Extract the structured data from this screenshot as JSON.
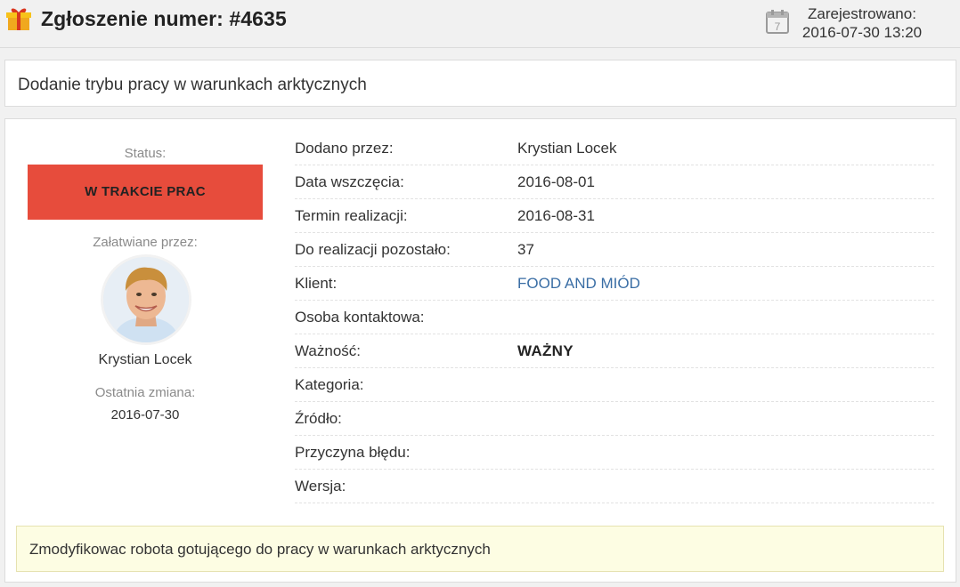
{
  "header": {
    "title": "Zgłoszenie numer: #4635",
    "registered_label": "Zarejestrowano:",
    "registered_value": "2016-07-30 13:20",
    "gift_icon": "gift-icon",
    "calendar_icon": "calendar-icon",
    "calendar_day": "7"
  },
  "subject": "Dodanie trybu pracy w warunkach arktycznych",
  "sidebar": {
    "status_label": "Status:",
    "status_value": "W TRAKCIE PRAC",
    "handler_label": "Załatwiane przez:",
    "handler_name": "Krystian Locek",
    "last_change_label": "Ostatnia zmiana:",
    "last_change_value": "2016-07-30"
  },
  "fields": [
    {
      "label": "Dodano przez:",
      "value": "Krystian Locek"
    },
    {
      "label": "Data wszczęcia:",
      "value": "2016-08-01"
    },
    {
      "label": "Termin realizacji:",
      "value": "2016-08-31"
    },
    {
      "label": "Do realizacji pozostało:",
      "value": "37"
    },
    {
      "label": "Klient:",
      "value": "FOOD AND MIÓD"
    },
    {
      "label": "Osoba kontaktowa:",
      "value": ""
    },
    {
      "label": "Ważność:",
      "value": "WAŻNY"
    },
    {
      "label": "Kategoria:",
      "value": ""
    },
    {
      "label": "Źródło:",
      "value": ""
    },
    {
      "label": "Przyczyna błędu:",
      "value": ""
    },
    {
      "label": "Wersja:",
      "value": ""
    }
  ],
  "description": "Zmodyfikowac robota gotującego do pracy w warunkach arktycznych",
  "colors": {
    "status": "#e74c3c",
    "link": "#3a6ea5",
    "note_bg": "#fdfde3"
  }
}
